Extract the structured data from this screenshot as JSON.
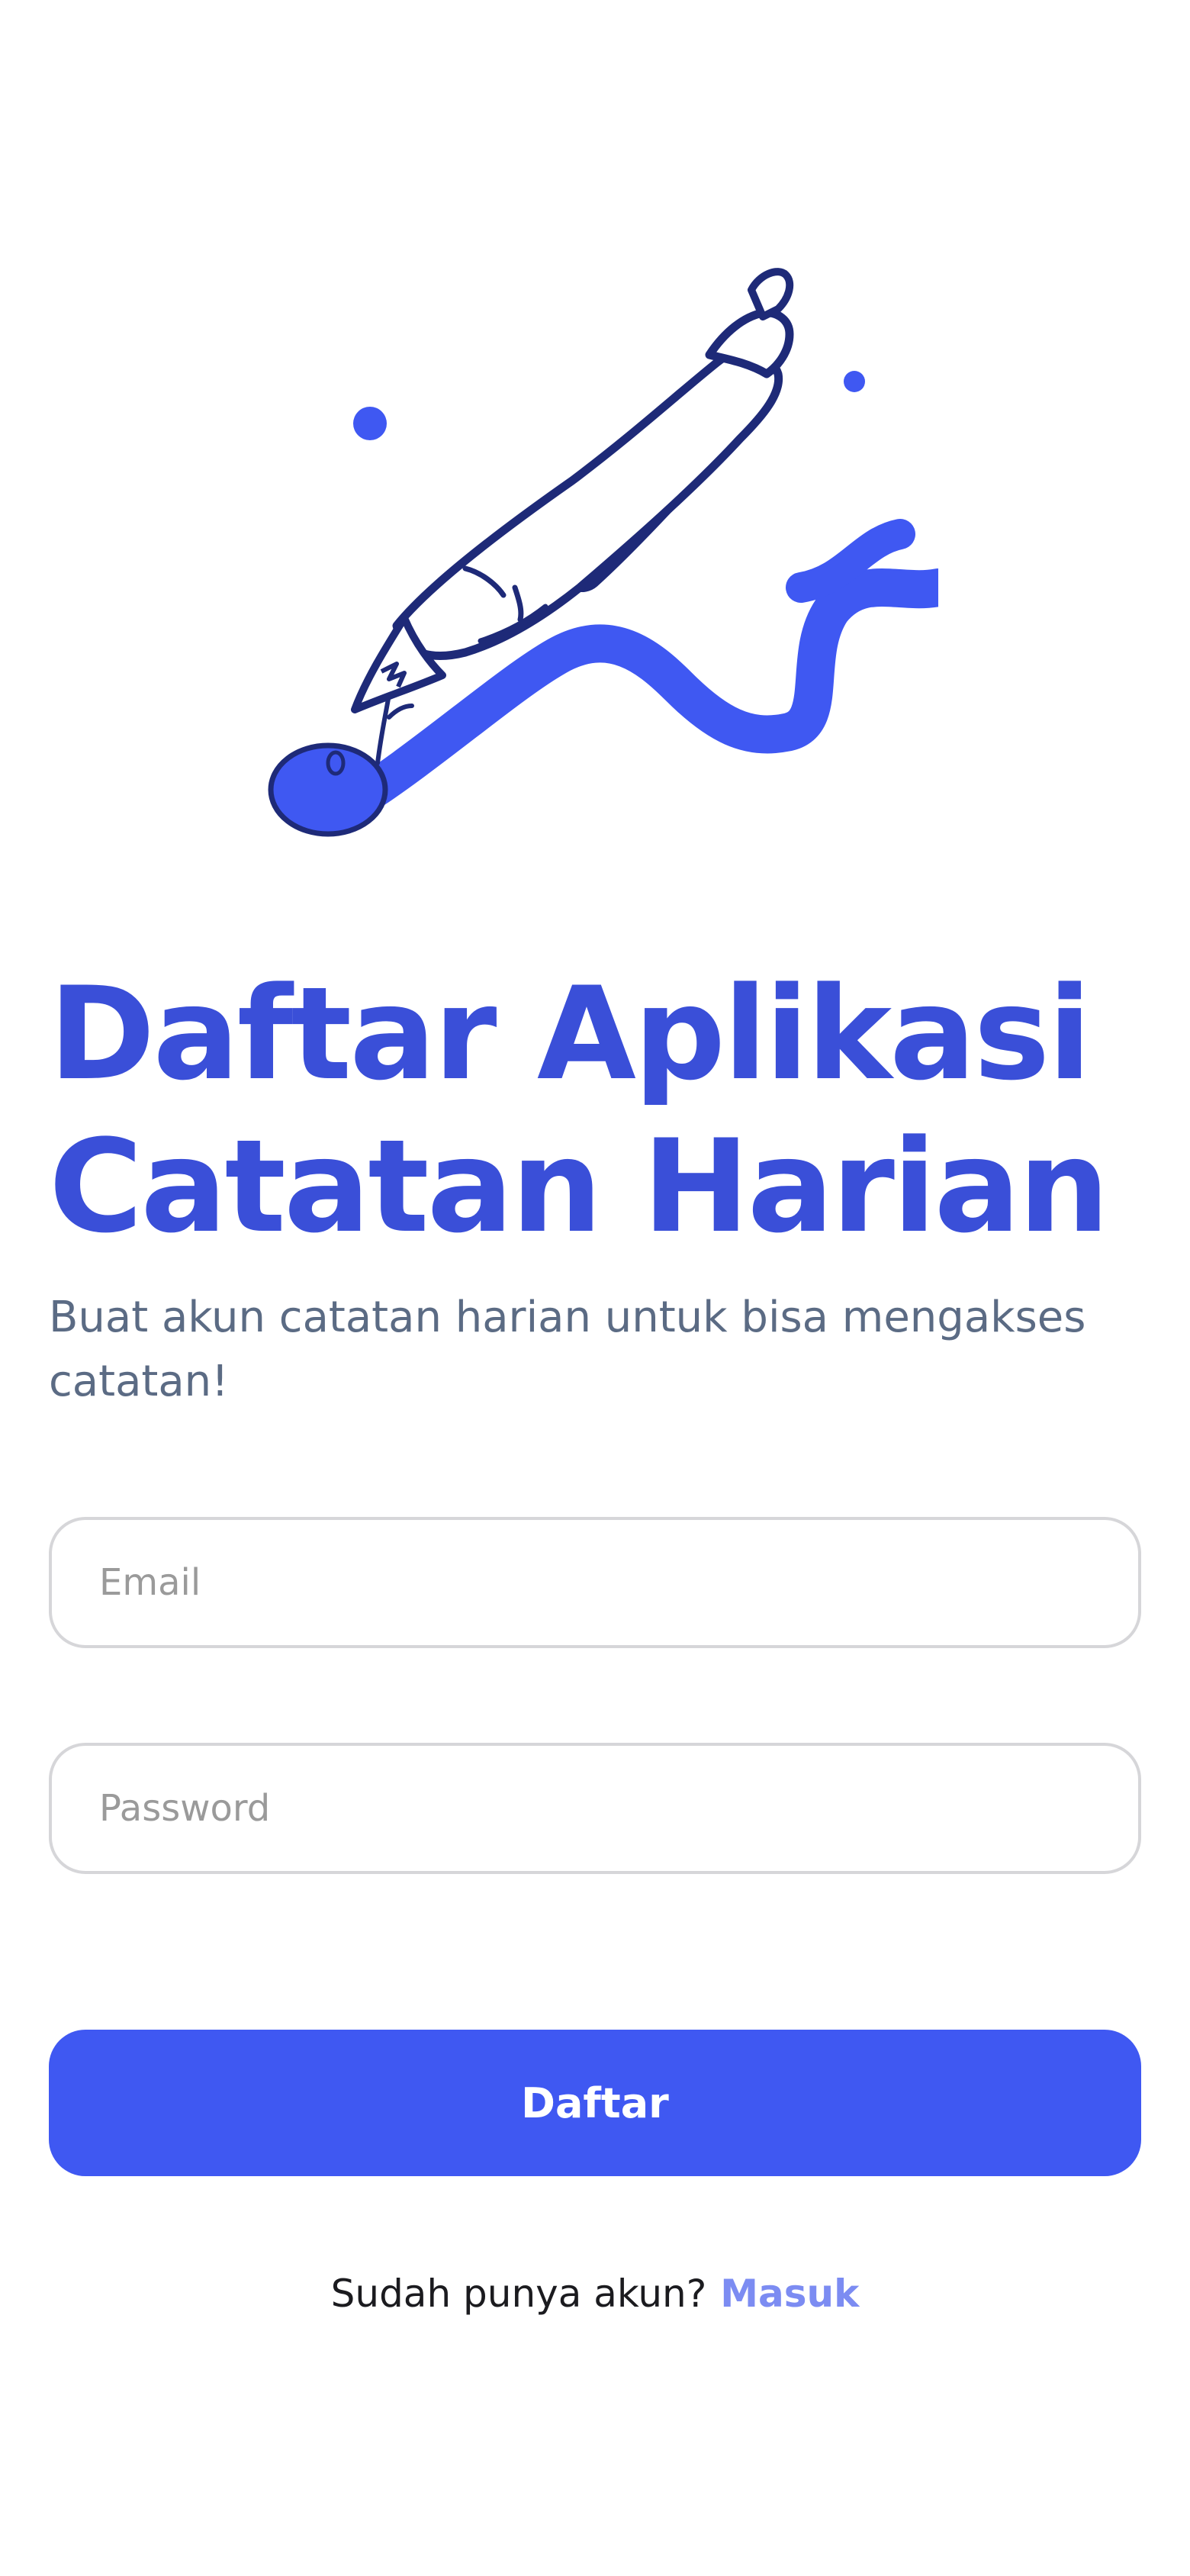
{
  "colors": {
    "primary": "#3f58f2",
    "title": "#3a4fd8",
    "illustration_dark": "#1e2a78",
    "illustration_accent": "#3f58f2",
    "subtitle": "#5b6b84",
    "link": "#7c8cf2",
    "input_border": "#d6d6d9",
    "background": "#ffffff"
  },
  "illustration": {
    "icon": "pen-with-ink-swirl-illustration"
  },
  "header": {
    "title_line1": "Daftar Aplikasi",
    "title_line2": "Catatan Harian",
    "subtitle": "Buat akun catatan harian untuk bisa mengakses catatan!"
  },
  "form": {
    "email_placeholder": "Email",
    "email_value": "",
    "password_placeholder": "Password",
    "password_value": "",
    "submit_label": "Daftar"
  },
  "footer": {
    "prompt": "Sudah punya akun?",
    "login_link": "Masuk"
  }
}
